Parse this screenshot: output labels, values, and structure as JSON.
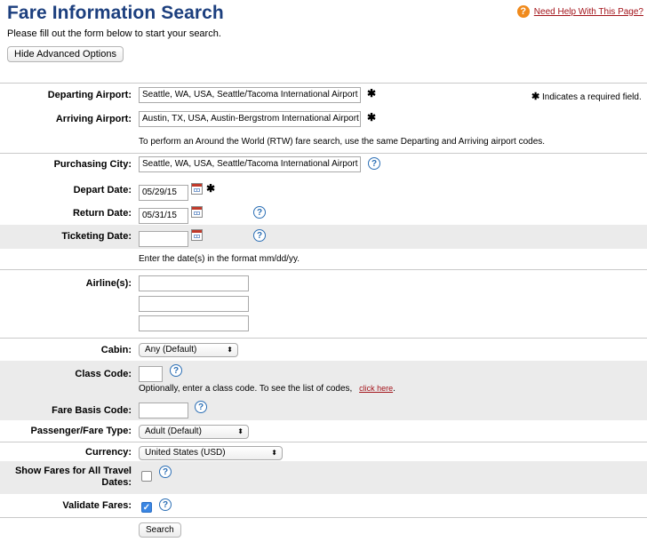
{
  "header": {
    "title": "Fare Information Search",
    "subtitle": "Please fill out the form below to start your search.",
    "help_link": "Need Help With This Page?",
    "hide_advanced": "Hide Advanced Options"
  },
  "form": {
    "departing": {
      "label": "Departing Airport:",
      "value": "Seattle, WA, USA, Seattle/Tacoma International Airport ("
    },
    "arriving": {
      "label": "Arriving Airport:",
      "value": "Austin, TX, USA, Austin-Bergstrom International Airport"
    },
    "required_note": "Indicates a required field.",
    "rtw_note": "To perform an Around the World (RTW) fare search, use the same Departing and Arriving airport codes.",
    "purchasing_city": {
      "label": "Purchasing City:",
      "value": "Seattle, WA, USA, Seattle/Tacoma International Airport ("
    },
    "depart_date": {
      "label": "Depart Date:",
      "value": "05/29/15"
    },
    "return_date": {
      "label": "Return Date:",
      "value": "05/31/15"
    },
    "ticketing_date": {
      "label": "Ticketing Date:",
      "value": ""
    },
    "date_format_note": "Enter the date(s) in the format mm/dd/yy.",
    "airlines": {
      "label": "Airline(s):",
      "values": [
        "",
        "",
        ""
      ]
    },
    "cabin": {
      "label": "Cabin:",
      "selected": "Any (Default)"
    },
    "class_code": {
      "label": "Class Code:",
      "value": "",
      "note": "Optionally, enter a class code. To see the list of codes,",
      "link": "click here",
      "note_end": "."
    },
    "fare_basis": {
      "label": "Fare Basis Code:",
      "value": ""
    },
    "passenger_type": {
      "label": "Passenger/Fare Type:",
      "selected": "Adult (Default)"
    },
    "currency": {
      "label": "Currency:",
      "selected": "United States (USD)"
    },
    "show_all_dates": {
      "label": "Show Fares for All Travel Dates:",
      "checked": false
    },
    "validate_fares": {
      "label": "Validate Fares:",
      "checked": true
    },
    "search_label": "Search"
  },
  "icons": {
    "required": "✱",
    "help": "?",
    "calendar": "calendar-icon",
    "select_arrow": "⬍",
    "check": "✓"
  },
  "colors": {
    "title": "#1c3f7e",
    "link": "#a3131a",
    "help_orange": "#f08a1c",
    "info_blue": "#2c6fb5",
    "row_gray": "#ebebeb"
  }
}
